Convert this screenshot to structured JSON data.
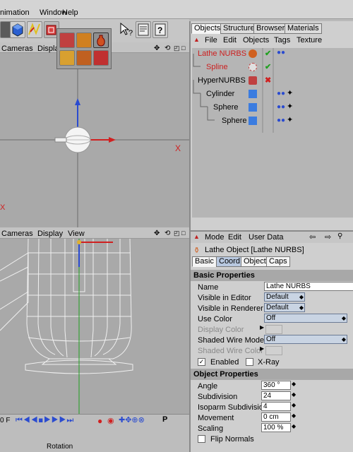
{
  "menu": {
    "animation": "nimation",
    "window": "Window",
    "help": "Help"
  },
  "viewport1": {
    "cameras": "Cameras",
    "display": "Displa",
    "axis_x": "X",
    "axis_x2": "X"
  },
  "viewport2": {
    "cameras": "Cameras",
    "display": "Display",
    "view": "View"
  },
  "timeline": {
    "frame": "0 F",
    "rotation": "Rotation"
  },
  "tabs": {
    "objects": "Objects",
    "structure": "Structure",
    "browser": "Browser",
    "materials": "Materials"
  },
  "obj_menu": {
    "file": "File",
    "edit": "Edit",
    "objects": "Objects",
    "tags": "Tags",
    "texture": "Texture"
  },
  "objects": [
    {
      "name": "Lathe NURBS",
      "color": "#cc2020"
    },
    {
      "name": "Spline",
      "color": "#cc2020"
    },
    {
      "name": "HyperNURBS",
      "color": "#000000"
    },
    {
      "name": "Cylinder",
      "color": "#000000"
    },
    {
      "name": "Sphere",
      "color": "#000000"
    },
    {
      "name": "Sphere",
      "color": "#000000"
    }
  ],
  "attr_menu": {
    "mode": "Mode",
    "edit": "Edit",
    "user_data": "User Data"
  },
  "attr_title": "Lathe Object [Lathe NURBS]",
  "attr_tabs": {
    "basic": "Basic",
    "coord": "Coord.",
    "object": "Object",
    "caps": "Caps"
  },
  "basic": {
    "heading": "Basic Properties",
    "name_label": "Name",
    "name_value": "Lathe NURBS",
    "vis_editor_label": "Visible in Editor",
    "vis_editor_value": "Default",
    "vis_render_label": "Visible in Renderer",
    "vis_render_value": "Default",
    "use_color_label": "Use Color",
    "use_color_value": "Off",
    "display_color_label": "Display Color",
    "shaded_wire_label": "Shaded Wire Mode",
    "shaded_wire_value": "Off",
    "shaded_wire_color_label": "Shaded Wire Color",
    "enabled_label": "Enabled",
    "xray_label": "X-Ray"
  },
  "objprops": {
    "heading": "Object Properties",
    "angle_label": "Angle",
    "angle_value": "360 °",
    "subdiv_label": "Subdivision",
    "subdiv_value": "24",
    "iso_label": "Isoparm Subdivision",
    "iso_value": "4",
    "movement_label": "Movement",
    "movement_value": "0 cm",
    "scaling_label": "Scaling",
    "scaling_value": "100 %",
    "flip_label": "Flip Normals"
  },
  "colors": {
    "accent": "#3060c0",
    "red": "#cc2020",
    "green": "#20a020"
  }
}
